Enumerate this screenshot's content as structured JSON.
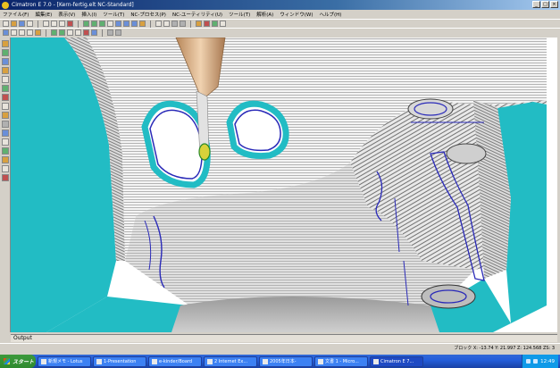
{
  "window": {
    "title": "Cimatron E 7.0 - [Kern-fertig.elt NC-Standard]",
    "controls": [
      "_",
      "□",
      "×"
    ]
  },
  "menu": [
    "ファイル(F)",
    "編集(E)",
    "表示(V)",
    "挿入(I)",
    "ツール(T)",
    "NC-プロセス(P)",
    "NC-ユーティリティ(U)",
    "ツール(T)",
    "解析(A)",
    "ウィンドウ(W)",
    "ヘルプ(H)"
  ],
  "output": {
    "label": "Output"
  },
  "status": {
    "coords": "ブロック  X: -13.74  Y: 21.997  Z: 124.568  ZS: 3"
  },
  "taskbar": {
    "start": "スタート",
    "items": [
      {
        "label": "新規メモ - Lotus",
        "active": false
      },
      {
        "label": "1-Presentation",
        "active": false
      },
      {
        "label": "e-kinder/Board",
        "active": false
      },
      {
        "label": "2 Internet Ex...",
        "active": false
      },
      {
        "label": "2005年日本-",
        "active": false
      },
      {
        "label": "文書 1 - Micro...",
        "active": false
      },
      {
        "label": "Cimatron E 7...",
        "active": true
      }
    ],
    "clock": "12:49"
  },
  "colors": {
    "teal": "#22bcc4",
    "toolpath": "#2a2ab8",
    "tool": "#c9a27a"
  }
}
